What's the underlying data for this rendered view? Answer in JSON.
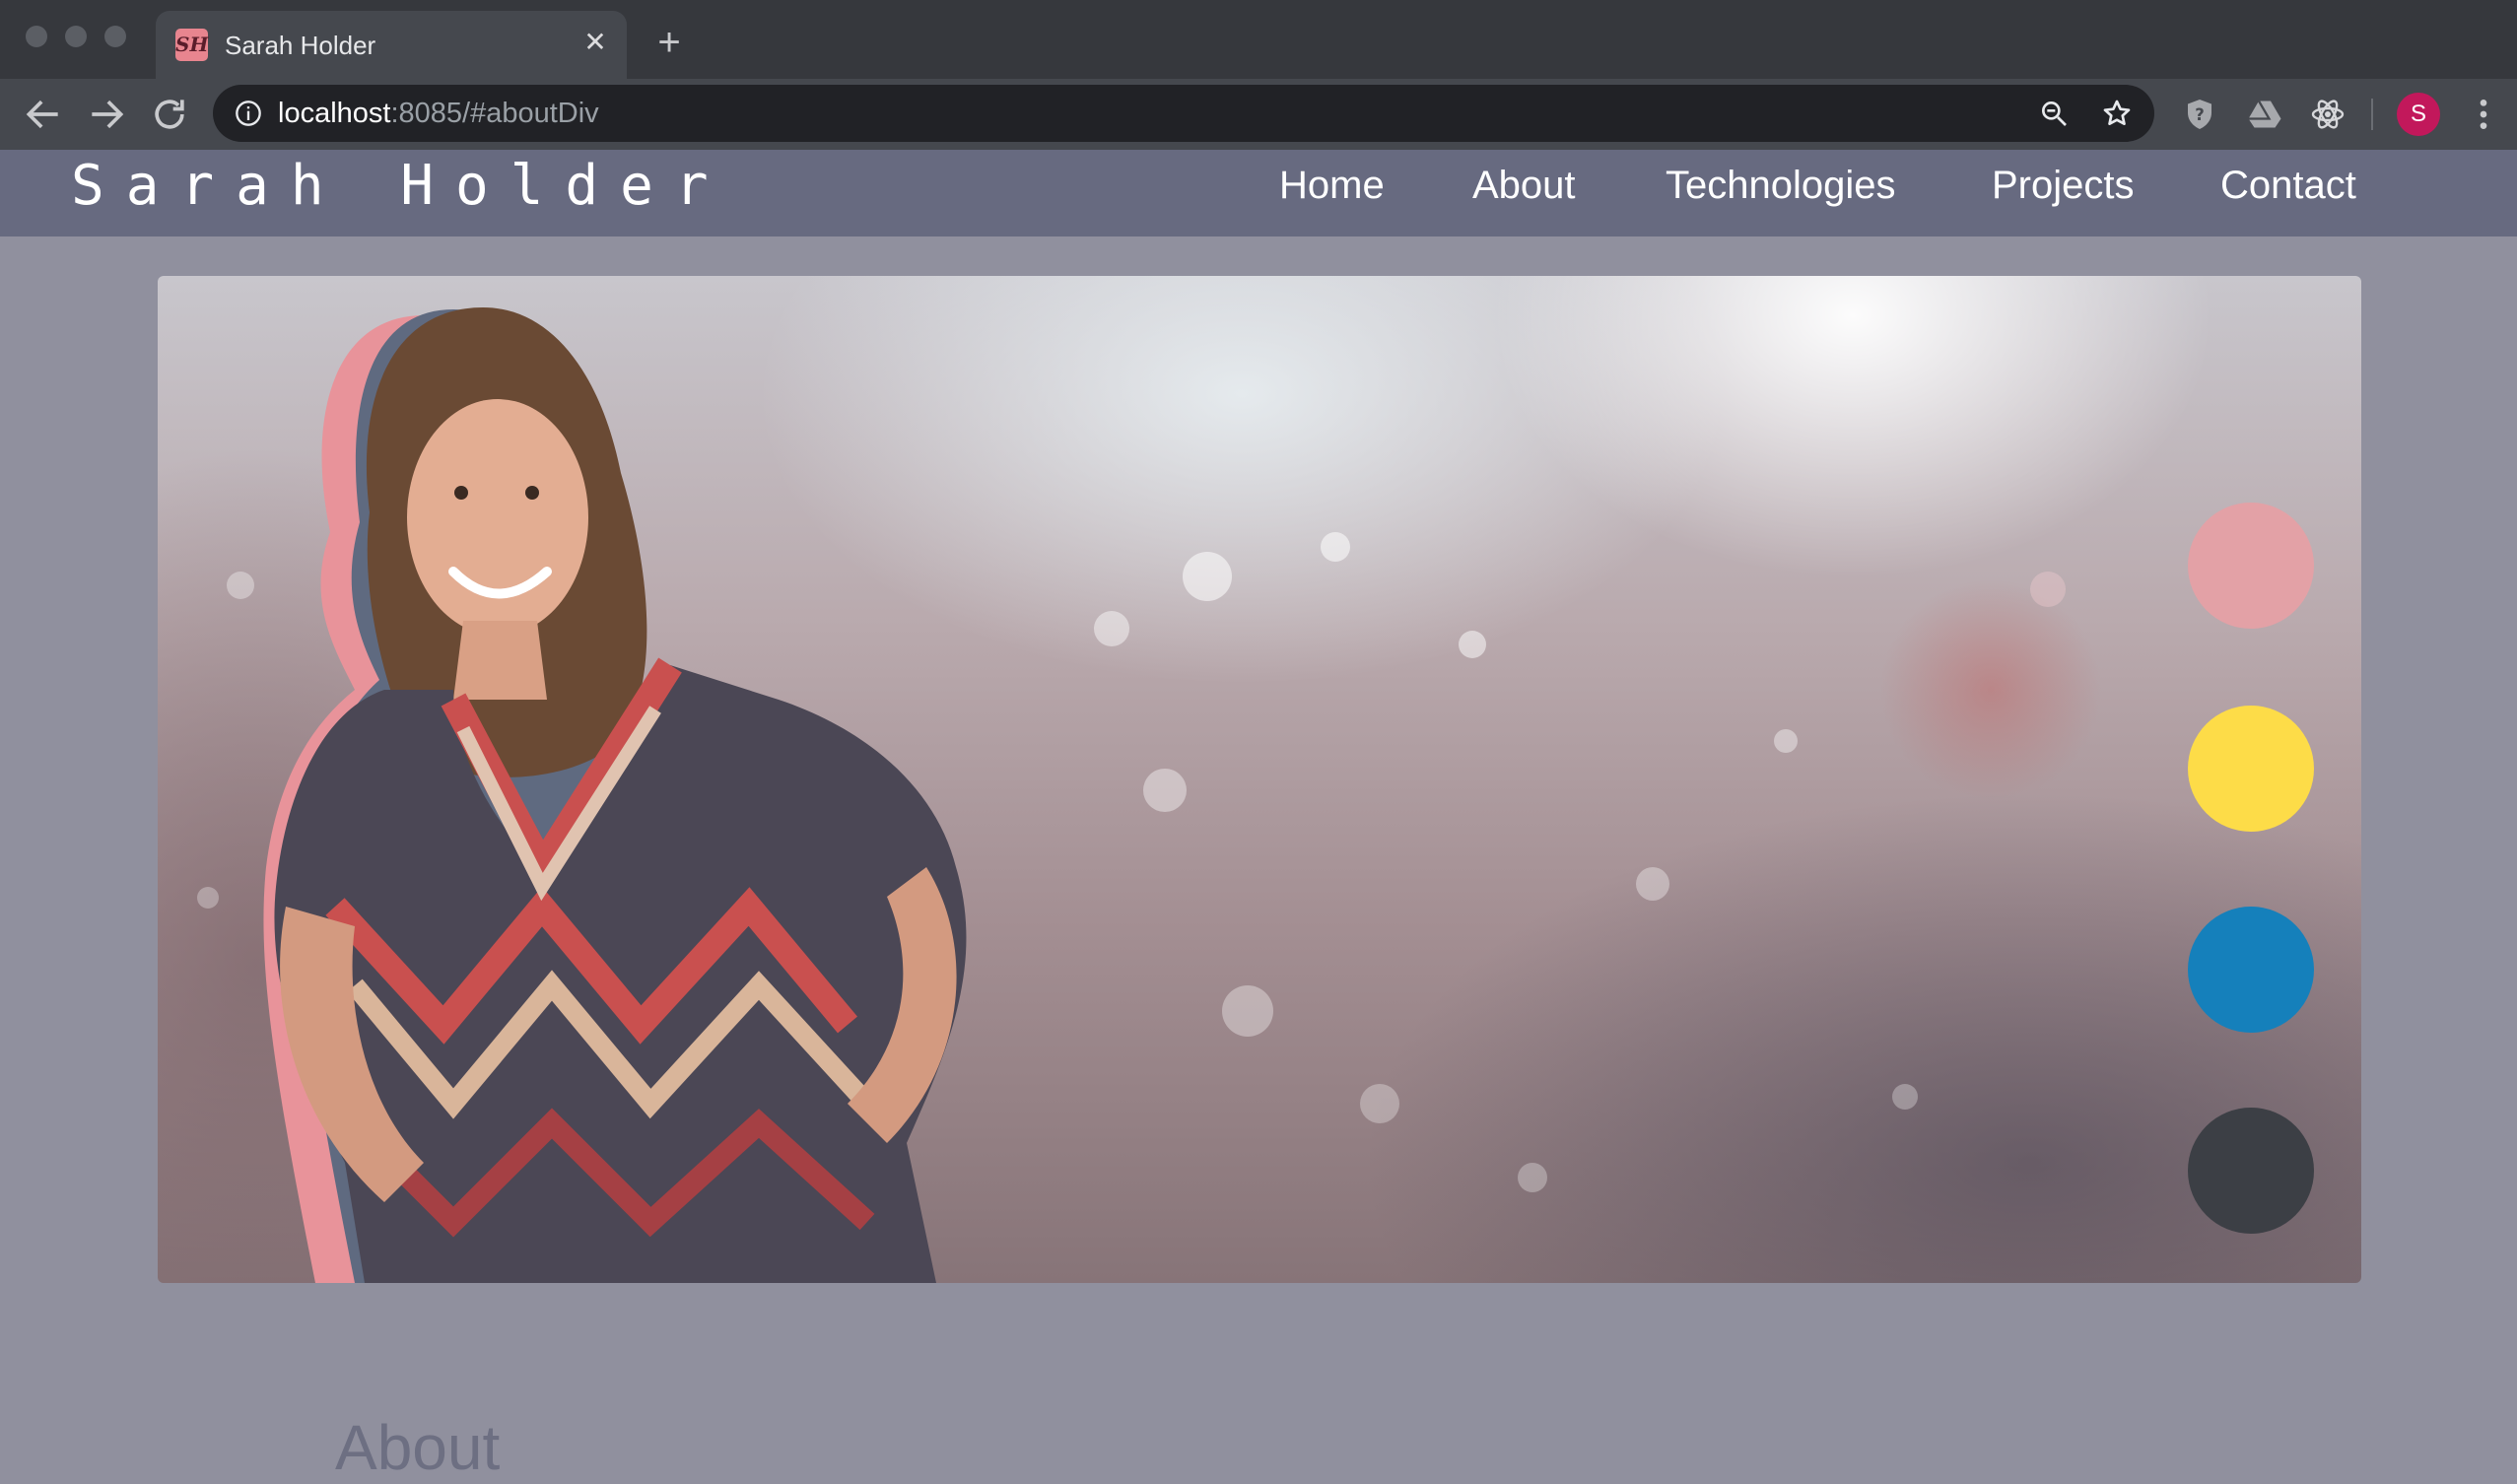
{
  "browser": {
    "tab_title": "Sarah Holder",
    "tab_favicon": "SH",
    "url_host": "localhost",
    "url_rest": ":8085/#aboutDiv",
    "profile_initial": "S",
    "icons": [
      "back-icon",
      "forward-icon",
      "reload-icon",
      "info-icon",
      "zoom-icon",
      "star-icon",
      "shield-extension-icon",
      "drive-extension-icon",
      "react-extension-icon",
      "menu-icon"
    ]
  },
  "site": {
    "brand": "Sarah Holder",
    "nav": [
      "Home",
      "About",
      "Technologies",
      "Projects",
      "Contact"
    ]
  },
  "hero": {
    "dot_colors": [
      "#e3a1a6",
      "#fddc48",
      "#1580bb",
      "#3c3f45"
    ]
  },
  "about": {
    "heading": "About"
  }
}
